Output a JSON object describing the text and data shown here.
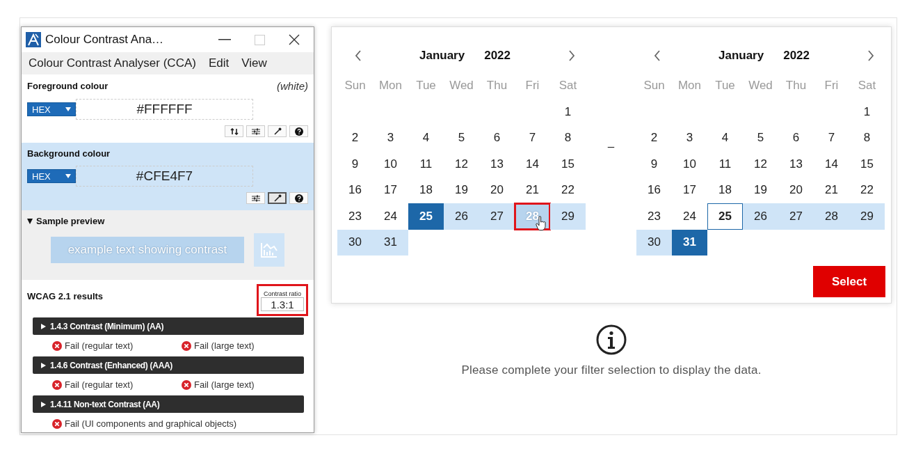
{
  "cca_window": {
    "title": "Colour Contrast Ana…",
    "menu": [
      "Colour Contrast Analyser (CCA)",
      "Edit",
      "View"
    ],
    "colours": [
      {
        "kind": "foreground",
        "label": "Foreground colour",
        "name": "(white)",
        "format": "HEX",
        "value": "#FFFFFF",
        "tools": [
          {
            "kind": "swap",
            "pressed": false
          },
          {
            "kind": "sliders",
            "pressed": false
          },
          {
            "kind": "eyedropper",
            "pressed": false
          },
          {
            "kind": "help",
            "pressed": false
          }
        ]
      },
      {
        "kind": "background",
        "label": "Background colour",
        "format": "HEX",
        "value": "#CFE4F7",
        "tools": [
          {
            "kind": "sliders",
            "pressed": false
          },
          {
            "kind": "eyedropper",
            "pressed": true
          },
          {
            "kind": "help",
            "pressed": false
          }
        ]
      }
    ],
    "sample_preview": {
      "label": "Sample preview",
      "expanded": true,
      "text": "example text showing contrast"
    },
    "results": {
      "label": "WCAG 2.1 results",
      "ratio_label": "Contrast ratio",
      "ratio": "1.3:1",
      "ratio_highlighted": true,
      "criteria": [
        {
          "title": "1.4.3 Contrast (Minimum) (AA)",
          "expanded": false,
          "outcomes": [
            {
              "text": "Fail (regular text)",
              "pass": false
            },
            {
              "text": "Fail (large text)",
              "pass": false
            }
          ]
        },
        {
          "title": "1.4.6 Contrast (Enhanced) (AAA)",
          "expanded": false,
          "outcomes": [
            {
              "text": "Fail (regular text)",
              "pass": false
            },
            {
              "text": "Fail (large text)",
              "pass": false
            }
          ]
        },
        {
          "title": "1.4.11 Non-text Contrast (AA)",
          "expanded": false,
          "outcomes": [
            {
              "text": "Fail (UI components and graphical objects)",
              "pass": false
            }
          ]
        }
      ]
    }
  },
  "date_picker": {
    "separator": "–",
    "button": "Select",
    "months": [
      {
        "month": "January",
        "year": "2022",
        "weekdays": [
          "Sun",
          "Mon",
          "Tue",
          "Wed",
          "Thu",
          "Fri",
          "Sat"
        ],
        "weeks": [
          [
            {
              "kind": "blank"
            },
            {
              "kind": "blank"
            },
            {
              "kind": "blank"
            },
            {
              "kind": "blank"
            },
            {
              "kind": "blank"
            },
            {
              "kind": "blank"
            },
            {
              "day": "1",
              "kind": "plain",
              "highlighted": false
            }
          ],
          [
            {
              "day": "2",
              "kind": "plain",
              "highlighted": false
            },
            {
              "day": "3",
              "kind": "plain",
              "highlighted": false
            },
            {
              "day": "4",
              "kind": "plain",
              "highlighted": false
            },
            {
              "day": "5",
              "kind": "plain",
              "highlighted": false
            },
            {
              "day": "6",
              "kind": "plain",
              "highlighted": false
            },
            {
              "day": "7",
              "kind": "plain",
              "highlighted": false
            },
            {
              "day": "8",
              "kind": "plain",
              "highlighted": false
            }
          ],
          [
            {
              "day": "9",
              "kind": "plain",
              "highlighted": false
            },
            {
              "day": "10",
              "kind": "plain",
              "highlighted": false
            },
            {
              "day": "11",
              "kind": "plain",
              "highlighted": false
            },
            {
              "day": "12",
              "kind": "plain",
              "highlighted": false
            },
            {
              "day": "13",
              "kind": "plain",
              "highlighted": false
            },
            {
              "day": "14",
              "kind": "plain",
              "highlighted": false
            },
            {
              "day": "15",
              "kind": "plain",
              "highlighted": false
            }
          ],
          [
            {
              "day": "16",
              "kind": "plain",
              "highlighted": false
            },
            {
              "day": "17",
              "kind": "plain",
              "highlighted": false
            },
            {
              "day": "18",
              "kind": "plain",
              "highlighted": false
            },
            {
              "day": "19",
              "kind": "plain",
              "highlighted": false
            },
            {
              "day": "20",
              "kind": "plain",
              "highlighted": false
            },
            {
              "day": "21",
              "kind": "plain",
              "highlighted": false
            },
            {
              "day": "22",
              "kind": "plain",
              "highlighted": false
            }
          ],
          [
            {
              "day": "23",
              "kind": "plain",
              "highlighted": false
            },
            {
              "day": "24",
              "kind": "plain",
              "highlighted": false
            },
            {
              "day": "25",
              "kind": "endpoint",
              "highlighted": false
            },
            {
              "day": "26",
              "kind": "range",
              "highlighted": false
            },
            {
              "day": "27",
              "kind": "range",
              "highlighted": false
            },
            {
              "day": "28",
              "kind": "hover",
              "highlighted": true
            },
            {
              "day": "29",
              "kind": "range",
              "highlighted": false
            }
          ],
          [
            {
              "day": "30",
              "kind": "range",
              "highlighted": false
            },
            {
              "day": "31",
              "kind": "range",
              "highlighted": false
            },
            {
              "kind": "blank"
            },
            {
              "kind": "blank"
            },
            {
              "kind": "blank"
            },
            {
              "kind": "blank"
            },
            {
              "kind": "blank"
            }
          ]
        ]
      },
      {
        "month": "January",
        "year": "2022",
        "weekdays": [
          "Sun",
          "Mon",
          "Tue",
          "Wed",
          "Thu",
          "Fri",
          "Sat"
        ],
        "weeks": [
          [
            {
              "kind": "blank"
            },
            {
              "kind": "blank"
            },
            {
              "kind": "blank"
            },
            {
              "kind": "blank"
            },
            {
              "kind": "blank"
            },
            {
              "kind": "blank"
            },
            {
              "day": "1",
              "kind": "plain",
              "highlighted": false
            }
          ],
          [
            {
              "day": "2",
              "kind": "plain",
              "highlighted": false
            },
            {
              "day": "3",
              "kind": "plain",
              "highlighted": false
            },
            {
              "day": "4",
              "kind": "plain",
              "highlighted": false
            },
            {
              "day": "5",
              "kind": "plain",
              "highlighted": false
            },
            {
              "day": "6",
              "kind": "plain",
              "highlighted": false
            },
            {
              "day": "7",
              "kind": "plain",
              "highlighted": false
            },
            {
              "day": "8",
              "kind": "plain",
              "highlighted": false
            }
          ],
          [
            {
              "day": "9",
              "kind": "plain",
              "highlighted": false
            },
            {
              "day": "10",
              "kind": "plain",
              "highlighted": false
            },
            {
              "day": "11",
              "kind": "plain",
              "highlighted": false
            },
            {
              "day": "12",
              "kind": "plain",
              "highlighted": false
            },
            {
              "day": "13",
              "kind": "plain",
              "highlighted": false
            },
            {
              "day": "14",
              "kind": "plain",
              "highlighted": false
            },
            {
              "day": "15",
              "kind": "plain",
              "highlighted": false
            }
          ],
          [
            {
              "day": "16",
              "kind": "plain",
              "highlighted": false
            },
            {
              "day": "17",
              "kind": "plain",
              "highlighted": false
            },
            {
              "day": "18",
              "kind": "plain",
              "highlighted": false
            },
            {
              "day": "19",
              "kind": "plain",
              "highlighted": false
            },
            {
              "day": "20",
              "kind": "plain",
              "highlighted": false
            },
            {
              "day": "21",
              "kind": "plain",
              "highlighted": false
            },
            {
              "day": "22",
              "kind": "plain",
              "highlighted": false
            }
          ],
          [
            {
              "day": "23",
              "kind": "plain",
              "highlighted": false
            },
            {
              "day": "24",
              "kind": "plain",
              "highlighted": false
            },
            {
              "day": "25",
              "kind": "focus",
              "highlighted": false
            },
            {
              "day": "26",
              "kind": "range",
              "highlighted": false
            },
            {
              "day": "27",
              "kind": "range",
              "highlighted": false
            },
            {
              "day": "28",
              "kind": "range",
              "highlighted": false
            },
            {
              "day": "29",
              "kind": "range",
              "highlighted": false
            }
          ],
          [
            {
              "day": "30",
              "kind": "range",
              "highlighted": false
            },
            {
              "day": "31",
              "kind": "endpoint",
              "highlighted": false
            },
            {
              "kind": "blank"
            },
            {
              "kind": "blank"
            },
            {
              "kind": "blank"
            },
            {
              "kind": "blank"
            },
            {
              "kind": "blank"
            }
          ]
        ]
      }
    ]
  },
  "message": "Please complete your filter selection to display the data."
}
